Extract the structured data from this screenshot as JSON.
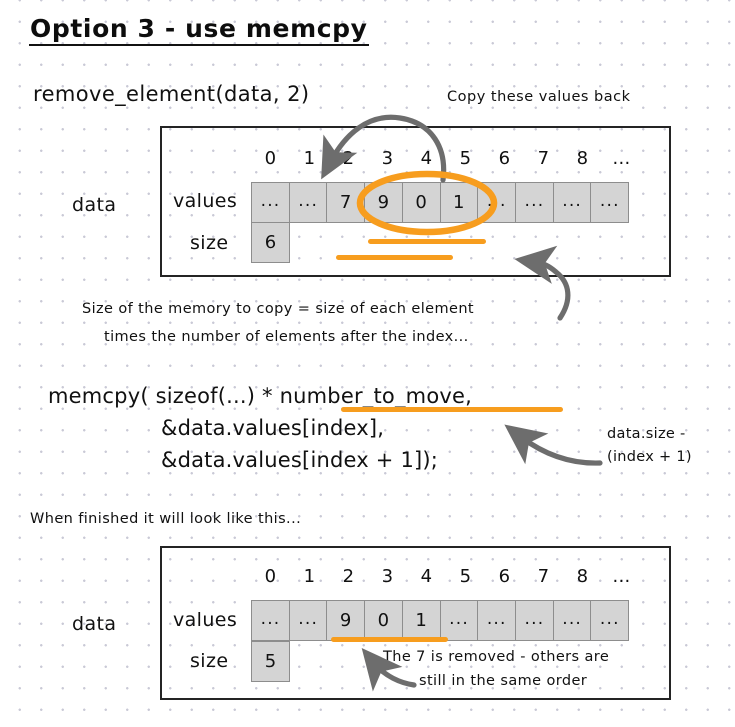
{
  "page": {
    "title": "Option 3 - use memcpy",
    "signature": "remove_element(data, 2)",
    "finished_note": "When finished it will look like this..."
  },
  "annotations": {
    "copy_back": "Copy these values back",
    "size_note_line1": "Size of the memory to copy = size of each element",
    "size_note_line2": "times the number of elements after the index...",
    "side_note_line1": "data.size -",
    "side_note_line2": "(index + 1)",
    "bottom_note_line1": "The 7 is removed - others are",
    "bottom_note_line2": "still in the same order"
  },
  "code": {
    "line1": "memcpy( sizeof(...) * number_to_move,",
    "line2": "&data.values[index],",
    "line3": "&data.values[index + 1]);"
  },
  "diagram_before": {
    "struct_label": "data",
    "values_label": "values",
    "size_label": "size",
    "indices": [
      "0",
      "1",
      "2",
      "3",
      "4",
      "5",
      "6",
      "7",
      "8",
      "..."
    ],
    "values": [
      "...",
      "...",
      "7",
      "9",
      "0",
      "1",
      "...",
      "...",
      "...",
      "..."
    ],
    "size_value": "6"
  },
  "diagram_after": {
    "struct_label": "data",
    "values_label": "values",
    "size_label": "size",
    "indices": [
      "0",
      "1",
      "2",
      "3",
      "4",
      "5",
      "6",
      "7",
      "8",
      "..."
    ],
    "values": [
      "...",
      "...",
      "9",
      "0",
      "1",
      "...",
      "...",
      "...",
      "...",
      "..."
    ],
    "size_value": "5"
  },
  "colors": {
    "highlight": "#f79d1e",
    "arrow": "#6d6d6d",
    "cell_fill": "#d4d4d4",
    "ink": "#111111"
  }
}
